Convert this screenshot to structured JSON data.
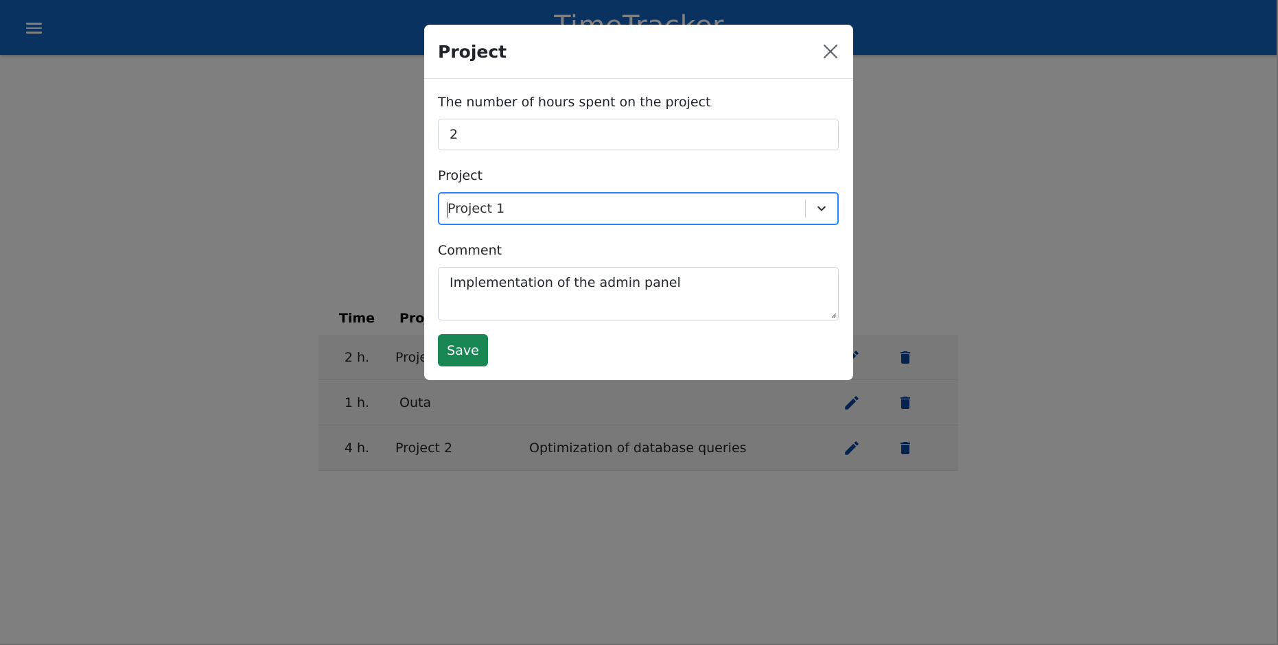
{
  "app": {
    "title": "TimeTracker"
  },
  "table": {
    "headers": {
      "time": "Time",
      "project": "Proj"
    },
    "rows": [
      {
        "time": "2 h.",
        "project": "Proje",
        "comment": ""
      },
      {
        "time": "1 h.",
        "project": "Outa",
        "comment": ""
      },
      {
        "time": "4 h.",
        "project": "Project 2",
        "comment": "Optimization of database queries"
      }
    ]
  },
  "modal": {
    "title": "Project",
    "hours_label": "The number of hours spent on the project",
    "hours_value": "2",
    "project_label": "Project",
    "project_value": "Project 1",
    "comment_label": "Comment",
    "comment_value": "Implementation of the admin panel",
    "save_label": "Save"
  },
  "icons": {
    "menu": "menu-icon",
    "edit": "pencil-icon",
    "delete": "trash-icon",
    "close": "close-icon",
    "dropdown": "chevron-down-icon"
  },
  "colors": {
    "app_bar": "#1565c0",
    "action_icon": "#0d47a1",
    "save_button": "#198754",
    "select_focus": "#2684ff"
  }
}
